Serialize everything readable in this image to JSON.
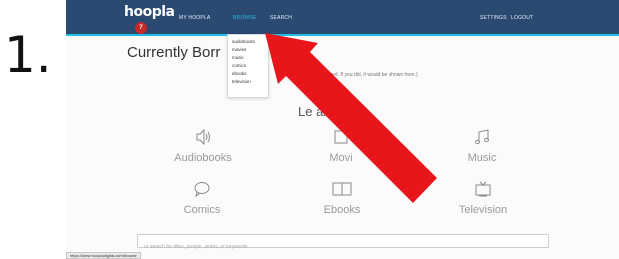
{
  "step_number": "1.",
  "header": {
    "logo": "hoopla",
    "badge_count": "7",
    "nav": [
      {
        "label": "MY HOOPLA",
        "active": false
      },
      {
        "label": "BROWSE",
        "active": true
      },
      {
        "label": "SEARCH",
        "active": false
      }
    ],
    "settings_label": "SETTINGS",
    "logout_label": "LOGOUT"
  },
  "browse_menu": {
    "items": [
      "audiobooks",
      "movies",
      "music",
      "comics",
      "ebooks",
      "television"
    ]
  },
  "main": {
    "title": "Currently Borr",
    "empty_note": "'t borrowed. If you did, it would be shown here.)",
    "cta": "Le          arted!",
    "categories": [
      {
        "label": "Audiobooks",
        "icon": "speaker-icon"
      },
      {
        "label": "Movi",
        "icon": "film-icon"
      },
      {
        "label": "Music",
        "icon": "music-note-icon"
      },
      {
        "label": "Comics",
        "icon": "speech-bubble-icon"
      },
      {
        "label": "Ebooks",
        "icon": "open-book-icon"
      },
      {
        "label": "Television",
        "icon": "tv-icon"
      }
    ]
  },
  "search": {
    "placeholder": "or search for titles, people, series, or keywords"
  },
  "status_bar": {
    "url": "https://www.hoopladigital.com/browse"
  },
  "annotation": {
    "arrow_color": "#e8161b"
  }
}
